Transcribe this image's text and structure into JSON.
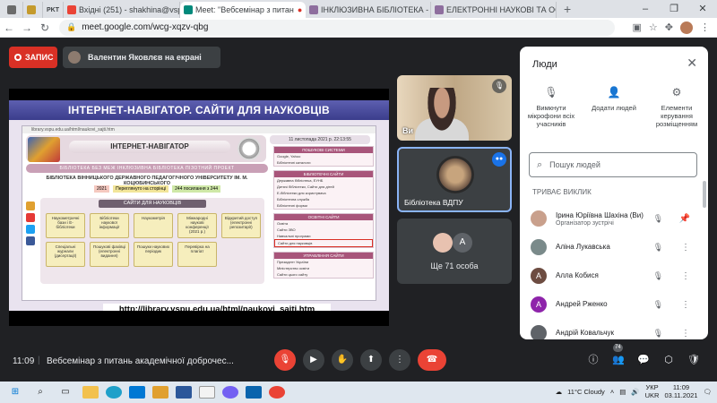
{
  "browser": {
    "tabs": [
      {
        "label": "",
        "color": "#6b6b6b"
      },
      {
        "label": "",
        "color": "#c49a2c"
      },
      {
        "label": "PKT",
        "color": "#1a1a1a"
      },
      {
        "label": "Вхідні (251) - shakhina@vspu.edu",
        "color": "#ea4335"
      },
      {
        "label": "Meet: \"Вебсемінар з питан",
        "color": "#00897b"
      },
      {
        "label": "ІНКЛЮЗИВНА БІБЛІОТЕКА - ІНТ",
        "color": "#8e6e9e"
      },
      {
        "label": "ЕЛЕКТРОННІ НАУКОВІ ТА ОСВІТ",
        "color": "#8e6e9e"
      }
    ],
    "new_tab": "+",
    "address": "meet.google.com/wcg-xqzv-qbg"
  },
  "meet": {
    "record_label": "ЗАПИС",
    "presenter_text": "Валентин Яковлєв на екрані",
    "slide": {
      "title": "ІНТЕРНЕТ-НАВІГАТОР. САЙТИ ДЛЯ НАУКОВЦІВ",
      "page_bar": "library.vspu.edu.ua/html/naukovi_sajti.htm",
      "header": "ІНТЕРНЕТ-НАВІГАТОР",
      "date": "11 листопада 2021 р.   22:13:55",
      "menu": "БІБЛІОТЕКА  БЕЗ МЕЖ   ІНКЛЮЗИВНА БІБЛІОТЕКА   ПІЗОТНИЙ ПРОЕКТ",
      "library_name": "БІБЛІОТЕКА ВІННИЦЬКОГО ДЕРЖАВНОГО ПЕДАГОГІЧНОГО УНІВЕРСИТЕТУ ІМ. М. КОЦЮБИНСЬКОГО",
      "stats": [
        "2021",
        "Переглянуто на сторінці",
        "244 посилання з 244"
      ],
      "cards_caption": "САЙТИ ДЛЯ НАУКОВЦІВ",
      "cards": [
        "Наукометричні бази і Е-бібліотеки",
        "Бібліотеки наукової інформації",
        "Наукометрія",
        "Міжнародні наукові конференції (2021 р.)",
        "Відкритий доступ (електронні репозитарії)",
        "Спеціальні журнали (дисертації)",
        "Пошукові фахівці (електронні видання)",
        "Пошуки наукових періодик",
        "Перевірка на плагіат",
        ""
      ],
      "side": [
        {
          "head": "ПОШУКОВІ СИСТЕМИ",
          "lines": [
            "Google, Yahoo",
            "Бібліотечні каталоги"
          ]
        },
        {
          "head": "БІБЛІОТЕЧНІ САЙТИ",
          "lines": [
            "Державна бібліотека, ЕУНБ",
            "Дитячі бібліотеки, Сайти для дітей",
            "Е-бібліотеки для користувача",
            "Бібліотечна служба",
            "Бібліотечні форми"
          ]
        },
        {
          "head": "ОСВІТНІ САЙТИ",
          "lines": [
            "Освіта",
            "Сайти ЗВО",
            "Навчальні програми",
            "Сайти для науковців"
          ]
        },
        {
          "head": "УПРАВЛІННЯ САЙТИ",
          "lines": [
            "Президент України",
            "Міністерство освіти",
            "Сайти цього сайту"
          ]
        }
      ],
      "url": "http://library.vspu.edu.ua/html/naukovi_sajti.htm"
    },
    "tiles": {
      "self_name": "Ви",
      "library_name": "Бібліотека ВДПУ",
      "others_avatar": "А",
      "others_count": "Ще 71 особа"
    }
  },
  "people": {
    "title": "Люди",
    "actions": [
      {
        "label": "Вимкнути мікрофони всіх учасників",
        "icon": "🎙"
      },
      {
        "label": "Додати людей",
        "icon": "👤"
      },
      {
        "label": "Елементи керування розміщенням",
        "icon": "⚙"
      }
    ],
    "search_placeholder": "Пошук людей",
    "section": "ТРИВАЄ ВИКЛИК",
    "participants": [
      {
        "name": "Ірина Юріївна Шахіна (Ви)",
        "role": "Організатор зустрічі",
        "avatar": "",
        "color": "#c9a08c"
      },
      {
        "name": "Аліна Лукавська",
        "role": "",
        "avatar": "",
        "color": "#7a8a8a"
      },
      {
        "name": "Алла Кобися",
        "role": "",
        "avatar": "А",
        "color": "#6d4c41"
      },
      {
        "name": "Андрей Рженко",
        "role": "",
        "avatar": "А",
        "color": "#8e24aa"
      },
      {
        "name": "Андрій Ковальчук",
        "role": "",
        "avatar": "",
        "color": "#5f6368"
      }
    ]
  },
  "bottom": {
    "time": "11:09",
    "title": "Вебсемінар з питань академічної доброчес...",
    "people_count": "74"
  },
  "taskbar": {
    "weather": "11°C  Cloudy",
    "lang": "УКР\nUKR",
    "clock_time": "11:09",
    "clock_date": "03.11.2021"
  }
}
